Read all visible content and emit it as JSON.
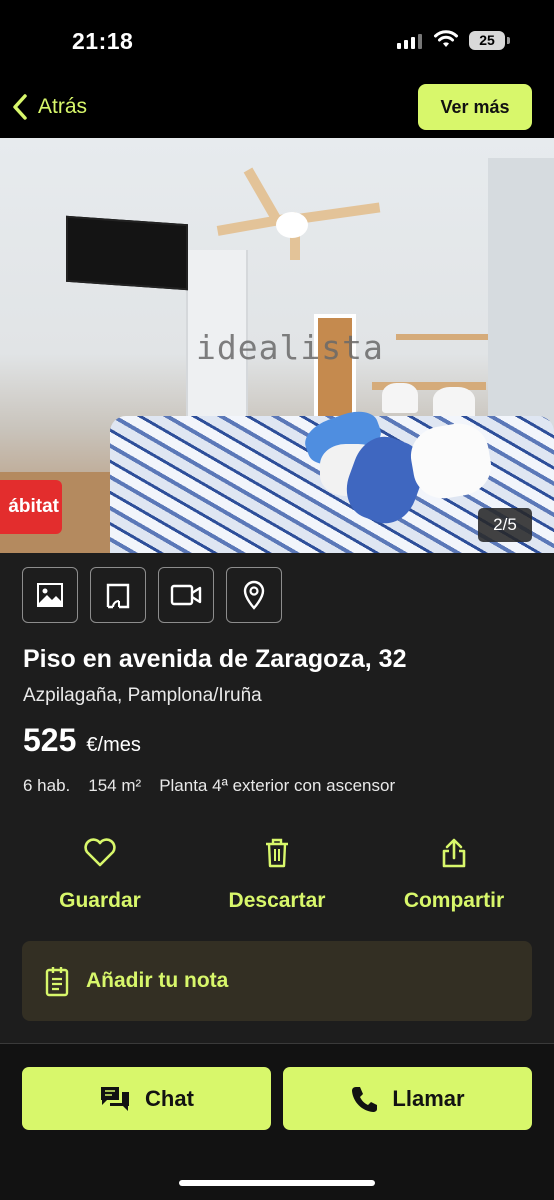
{
  "status_bar": {
    "time": "21:18",
    "battery": "25",
    "icons": [
      "signal-icon",
      "wifi-icon",
      "battery-icon"
    ]
  },
  "nav": {
    "back_label": "Atrás",
    "more_label": "Ver más"
  },
  "gallery": {
    "watermark": "idealista",
    "agency_badge": "ábitat",
    "counter": "2/5"
  },
  "media_tabs": [
    "photos-icon",
    "floorplan-icon",
    "video-icon",
    "map-pin-icon"
  ],
  "listing": {
    "title": "Piso en avenida de Zaragoza, 32",
    "location": "Azpilagaña, Pamplona/Iruña",
    "price": "525",
    "price_unit": "€/mes",
    "features": [
      "6 hab.",
      "154 m²",
      "Planta 4ª exterior con ascensor"
    ]
  },
  "actions": {
    "save": "Guardar",
    "discard": "Descartar",
    "share": "Compartir"
  },
  "note": {
    "label": "Añadir tu nota"
  },
  "footer": {
    "chat": "Chat",
    "call": "Llamar"
  },
  "colors": {
    "accent": "#d8f76b",
    "background": "#1d1d1d",
    "note_bg": "#332f23"
  }
}
